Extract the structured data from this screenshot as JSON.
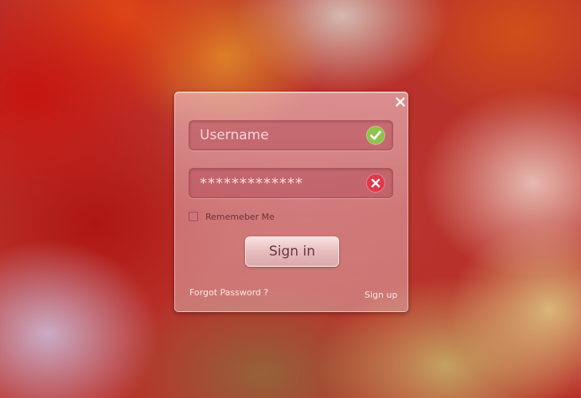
{
  "login": {
    "username_placeholder": "Username",
    "password_value": "*************",
    "remember_label": "Rememeber Me",
    "signin_label": "Sign in",
    "forgot_label": "Forgot Password ?",
    "signup_label": "Sign up"
  },
  "icons": {
    "close": "close-icon",
    "username_status": "check-icon",
    "password_status": "error-x-icon"
  },
  "colors": {
    "valid": "#8fc34a",
    "invalid": "#e1394a"
  }
}
